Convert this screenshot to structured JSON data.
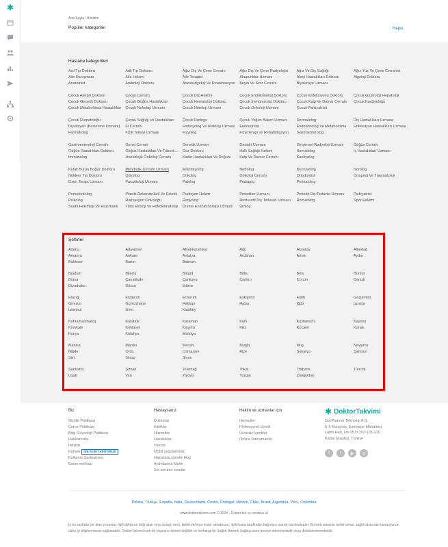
{
  "sidebar": {
    "icons": [
      "logo-icon",
      "calendar-icon",
      "chat-icon",
      "users-icon",
      "stats-icon",
      "send-icon",
      "network-icon",
      "settings-icon"
    ]
  },
  "header": {
    "breadcrumb": "Ana Sayfa / Klinikim",
    "title": "Popüler kategoriler",
    "all_link": "Hepsi"
  },
  "hospital_categories": {
    "title": "Hastane kategorileri",
    "groups": [
      [
        "Acil Tıp Doktoru",
        "Adli Tıp Doktoru",
        "Ağız Diş Ve Çene Cerrahı",
        "Ağız Diş Ve Çene Radyolojisi",
        "Ağız Ve Diş Sağlığı",
        "Ağız Yüz Ve Çene Cerrahisi",
        "Aile Danışmanı",
        "Aile Hekimi",
        "Aile Terapisi",
        "Akupunktur Uzmanı",
        "Alerji Hastalıkları Doktoru",
        "Algoloji Doktoru",
        "Anatomist",
        "Androloji Doktoru",
        "Anesteziyoloji Ve Reanimasyon",
        "Beyin Ve Sinir Cerrahı",
        "Biyokimya Uzmanı",
        ""
      ],
      [
        "Çocuk Alerjisi Doktoru",
        "Çocuk Cerrahı",
        "Çocuk Diş Hekimi",
        "Çocuk Endokrinoloji Doktoru",
        "Çocuk Enfeksiyonu Doktoru",
        "Çocuk Gastroloji Hepatoloji",
        "Çocuk Genetik Doktoru",
        "Çocuk Göğüs Hastalıkları",
        "Çocuk Hematoloji Doktoru",
        "Çocuk İmmünolojisi Doktoru",
        "Çocuk Kalp Ve Damar Cerrahı",
        "Çocuk Kardiyoloğu",
        "Çocuk Metabolizma Hastalıkları",
        "Çocuk Nefroloji Uzmanı",
        "Çocuk Nöroloji Uzmanı",
        "Çocuk Onkoloji Uzmanı",
        "Çocuk Psikiyatristi",
        ""
      ],
      [
        "Çocuk Romatoloğu",
        "Çocuk Sağlığı Ve Hastalıkları",
        "Çocuk Ürologu",
        "Çocuk Yoğun Bakım Uzmanı",
        "Dermatolog",
        "Diş Hastalıkları Uzmanı",
        "Diyetisyen (Beslenme Uzmanı)",
        "El Cerrahı",
        "Embriyolog Ve Histoloji Uzmanı",
        "Endodontist",
        "Endokrinolog Ve Metabolizma",
        "Enfeksiyon Hastalıkları Uzmanı",
        "Farmakolog",
        "Fizik Tedavi Uzmanı",
        "Fizyolog",
        "Fizyoterapi ve Rehabilitasyon",
        "Gastroenterolog",
        ""
      ],
      [
        "Gastroenteroloji Cerrahı",
        "Genel Cerrah",
        "Genetik Uzmanı",
        "Geriatri Uzmanı",
        "Girişimsel Radyoloji Uzmanı",
        "Göğüs Cerrahı",
        "Göğüs Hastalıkları Doktoru",
        "Göğüs Hastalıkları Ve Tüberküloz",
        "Göz Doktoru",
        "Halk Sağlığı Hekimi",
        "Hematolog",
        "İç Hastalıkları Uzmanı",
        "İmmünolog",
        "Jinekolojik Onkoloji Cerrahı",
        "Kadın Hastalıkları Ve Doğum",
        "Kalp Ve Damar Cerrahı",
        "Kardiyolog",
        ""
      ],
      [
        "Kulak Burun Boğaz Doktoru",
        "Metabolik Cerrahi Uzmanı",
        "Mikrobiyolog",
        "Nefrolog",
        "Neonatolog",
        "Nörolog",
        "Nükleer Tıp Doktoru",
        "Odyolog",
        "Onkolog",
        "Onkoloji Cerrahı",
        "Ortodontist",
        "Ortopedi Ve Travmatoloji",
        "Ozon Terapi Uzmanı",
        "Parazitoloji Uzmanı",
        "Patolog",
        "Pedagog",
        "Perinatolog",
        ""
      ],
      [
        "Periodontolog",
        "Plastik Rekonstrüktif Ve Estetik",
        "Pratisyen Hekim",
        "Protetiker Uzmanı",
        "Protetik Diş Tedavisi Uzmanı",
        "Psikiyatrist",
        "Psikolog",
        "Radyasyon Onkoloğu",
        "Radyolog",
        "Restoratif Diş Tedavisi Uzmanı",
        "Romatolog",
        "Spor Hekimi",
        "Suatlı Hekimliği Ve Hiperbarik",
        "Tıbbi Ekoloji Ve Hidroklimatoloji",
        "Üreme Endokrinolojisi Uzmanı",
        "Ürolog",
        "",
        ""
      ]
    ]
  },
  "cities": {
    "title": "Şehirler",
    "groups": [
      [
        "Adana",
        "Adıyaman",
        "Afyonkarahisar",
        "Ağrı",
        "Aksaray",
        "Altındağ",
        "Amasya",
        "Ankara",
        "Antalya",
        "Ardahan",
        "Artvin",
        "Aydın",
        "Balıkesir",
        "Bartın",
        "Batman",
        "",
        "",
        ""
      ],
      [
        "Bayburt",
        "Bilecik",
        "Bingöl",
        "Bitlis",
        "Bolu",
        "Burdur",
        "Bursa",
        "Çanakkale",
        "Çankaya",
        "Çankırı",
        "Çorum",
        "Denizli",
        "Diyarbakır",
        "Düzce",
        "Edirne",
        "",
        "",
        ""
      ],
      [
        "Elazığ",
        "Erzincan",
        "Erzurum",
        "Eskişehir",
        "Fatih",
        "Gaziantep",
        "Giresun",
        "Gümüşhane",
        "Hakkari",
        "Hatay",
        "Iğdır",
        "Isparta",
        "İstanbul",
        "İzmir",
        "Kadıköy",
        "",
        "",
        ""
      ],
      [
        "Kahramanmaraş",
        "Karabük",
        "Karaman",
        "Kars",
        "Kastamonu",
        "Kayseri",
        "Kırıkkale",
        "Kırklareli",
        "Kırşehir",
        "Kilis",
        "Kocaeli",
        "Konak",
        "Konya",
        "Kütahya",
        "Malatya",
        "",
        "",
        ""
      ],
      [
        "Manisa",
        "Mardin",
        "Mersin",
        "Muğla",
        "Muş",
        "Nevşehir",
        "Niğde",
        "Ordu",
        "Osmaniye",
        "Rize",
        "Sakarya",
        "Samsun",
        "Siirt",
        "Sinop",
        "Sivas",
        "",
        "",
        ""
      ],
      [
        "Şanlıurfa",
        "Şırnak",
        "Tekirdağ",
        "Tokat",
        "Trabzon",
        "Tunceli",
        "Uşak",
        "Van",
        "Yalova",
        "Yozgat",
        "Zonguldak",
        "",
        "",
        "",
        "",
        "",
        "",
        ""
      ]
    ]
  },
  "footer": {
    "col1": {
      "title": "Biz",
      "items": [
        "Gizlilik Politikası",
        "Çerez Politikası",
        "Bilgi Güvenliği Politikası",
        "Hakkımızda",
        "İletişim",
        "Kariyer",
        "Kullanım Şartnamesi",
        "Basın merkezi"
      ],
      "badge": "İŞE ALIM YAPIYORUZ!"
    },
    "col2": {
      "title": "Hastaysanız",
      "items": [
        "Doktorlar",
        "Klinikler",
        "Hizmetler",
        "Hastalıklar",
        "Yardım",
        "Mobil uygulamalar",
        "Hastalara yönelik blog",
        "Aydınlatma Metni",
        "Sık sorulan sorular"
      ]
    },
    "col3": {
      "title": "Hekim ve uzmanlar için",
      "items": [
        "Hizmetler",
        "Profesyonel Üyelik",
        "Ücretsiz İçerikler",
        "Online Danışmanlık"
      ]
    },
    "brand": {
      "name": "DoktorTakvimi",
      "lines": [
        "DocPlanner Teknoloji A.Ş.",
        "E-5 Karayolu, Esentepe Mahallesi,",
        "Lapis Han, No:25 D:102-103-120",
        "Kartal İstanbul, Türkiye"
      ]
    },
    "social": [
      "f",
      "t",
      "▶",
      "◎"
    ],
    "countries": "Polska, Türkiye, España, Italia, Deutschland, Česko, Portugal, México, Chile, Brasil, Argentina, Perú, Colombia",
    "copyright": "www.doktortakvimi.com © 2024 - Doktor bul ve randevu al",
    "disclaimer": "İş bu sayfada yer alan yorumlar, ilgili doktorun doğrudan veya dolaylı emri, talebi ve/veya ricası olmaksızın, ilgili hasta tarafından bağımsız olarak yazılmaktadır. Bu web sitesinin temel amacı sağlık alanında kamuoyunun daha iyi bilgilenmesini sağlamaktır. DoktorTakvimi.com bir başvuru hizmeti değildir ve herhangi bir Sağlık Hizmeti Sağlayıcısını tavsiye etmemektedir veya desteklememektedir."
  },
  "colors": {
    "accent": "#1a73c7",
    "brand": "#00b39f",
    "highlight": "#e00000"
  }
}
